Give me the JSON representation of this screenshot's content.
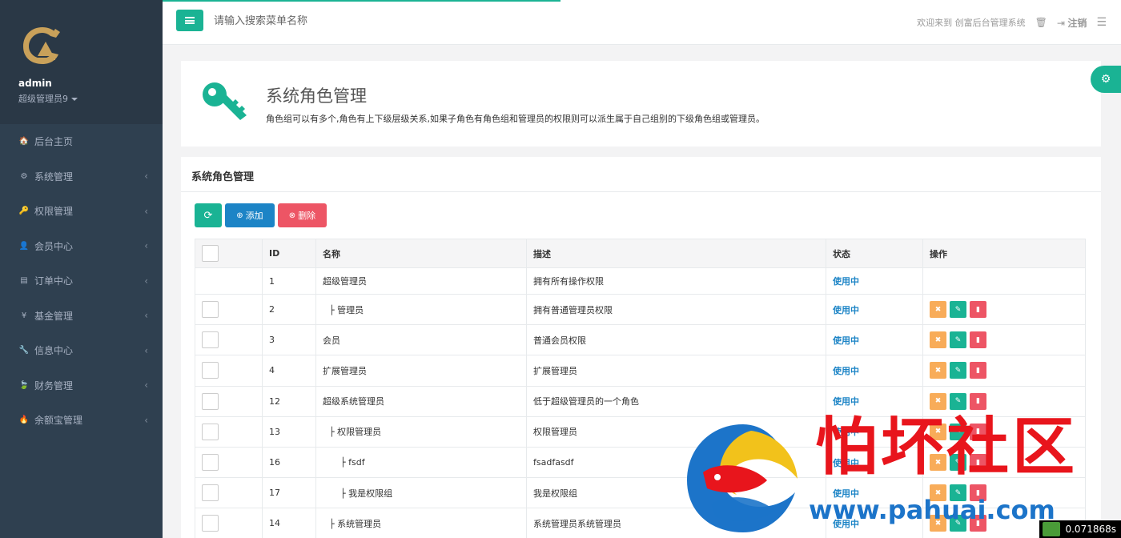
{
  "profile": {
    "username": "admin",
    "role": "超级管理员9"
  },
  "nav": [
    {
      "icon": "home-icon",
      "glyph": "🏠",
      "label": "后台主页",
      "chevron": ""
    },
    {
      "icon": "cogs-icon",
      "glyph": "⚙",
      "label": "系统管理",
      "chevron": "‹"
    },
    {
      "icon": "key-icon",
      "glyph": "🔑",
      "label": "权限管理",
      "chevron": "‹"
    },
    {
      "icon": "user-icon",
      "glyph": "👤",
      "label": "会员中心",
      "chevron": "‹"
    },
    {
      "icon": "list-icon",
      "glyph": "▤",
      "label": "订单中心",
      "chevron": "‹"
    },
    {
      "icon": "yen-icon",
      "glyph": "¥",
      "label": "基金管理",
      "chevron": "‹"
    },
    {
      "icon": "wrench-icon",
      "glyph": "🔧",
      "label": "信息中心",
      "chevron": "‹"
    },
    {
      "icon": "leaf-icon",
      "glyph": "🍃",
      "label": "财务管理",
      "chevron": "‹"
    },
    {
      "icon": "fire-icon",
      "glyph": "🔥",
      "label": "余额宝管理",
      "chevron": "‹"
    }
  ],
  "header": {
    "search_placeholder": "请输入搜索菜单名称",
    "welcome": "欢迎来到 创富后台管理系统",
    "logout": "注销"
  },
  "page": {
    "title": "系统角色管理",
    "description": "角色组可以有多个,角色有上下级层级关系,如果子角色有角色组和管理员的权限则可以派生属于自己组别的下级角色组或管理员。"
  },
  "panel": {
    "title": "系统角色管理",
    "add_label": "添加",
    "delete_label": "删除"
  },
  "table": {
    "headers": {
      "id": "ID",
      "name": "名称",
      "desc": "描述",
      "status": "状态",
      "ops": "操作"
    },
    "rows": [
      {
        "id": "1",
        "name": "超级管理员",
        "desc": "拥有所有操作权限",
        "status": "使用中"
      },
      {
        "id": "2",
        "name": "├ 管理员",
        "desc": "拥有普通管理员权限",
        "status": "使用中"
      },
      {
        "id": "3",
        "name": "会员",
        "desc": "普通会员权限",
        "status": "使用中"
      },
      {
        "id": "4",
        "name": "扩展管理员",
        "desc": "扩展管理员",
        "status": "使用中"
      },
      {
        "id": "12",
        "name": "超级系统管理员",
        "desc": "低于超级管理员的一个角色",
        "status": "使用中"
      },
      {
        "id": "13",
        "name": "├ 权限管理员",
        "desc": "权限管理员",
        "status": "使用中"
      },
      {
        "id": "16",
        "name": "├ fsdf",
        "desc": "fsadfasdf",
        "status": "使用中"
      },
      {
        "id": "17",
        "name": "├ 我是权限组",
        "desc": "我是权限组",
        "status": "使用中"
      },
      {
        "id": "14",
        "name": "├ 系统管理员",
        "desc": "系统管理员系统管理员",
        "status": "使用中"
      }
    ]
  },
  "watermark": {
    "text": "怕坏社区",
    "url": "www.pahuai.com"
  },
  "timer": "0.071868s",
  "colors": {
    "primary": "#1ab394",
    "info": "#1c84c6",
    "danger": "#ed5565",
    "warning": "#f8ac59",
    "sidebar": "#2f4050"
  }
}
